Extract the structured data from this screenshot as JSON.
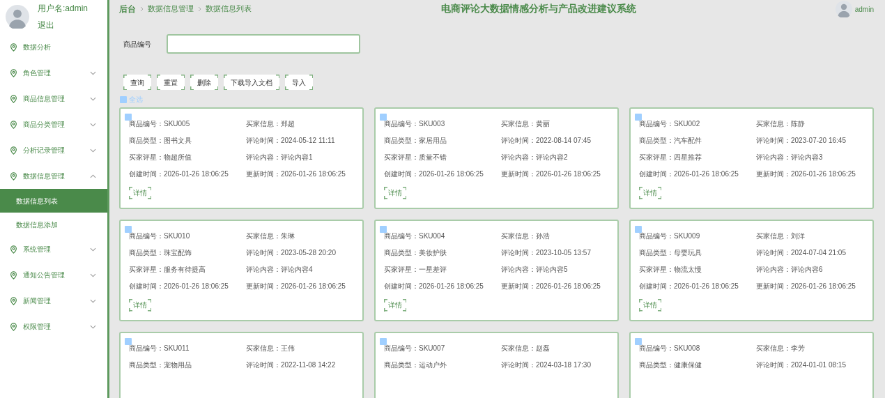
{
  "user": {
    "username": "用户名:admin",
    "logout": "退出"
  },
  "sidebar": {
    "items": [
      {
        "kind": "link",
        "label": "数据分析"
      },
      {
        "kind": "submenu",
        "label": "角色管理",
        "expanded": false
      },
      {
        "kind": "submenu",
        "label": "商品信息管理",
        "expanded": false
      },
      {
        "kind": "submenu",
        "label": "商品分类管理",
        "expanded": false
      },
      {
        "kind": "submenu",
        "label": "分析记录管理",
        "expanded": false
      },
      {
        "kind": "submenu",
        "label": "数据信息管理",
        "expanded": true,
        "children": [
          {
            "label": "数据信息列表",
            "selected": true
          },
          {
            "label": "数据信息添加",
            "selected": false
          }
        ]
      },
      {
        "kind": "submenu",
        "label": "系统管理",
        "expanded": false
      },
      {
        "kind": "submenu",
        "label": "通知公告管理",
        "expanded": false
      },
      {
        "kind": "submenu",
        "label": "新闻管理",
        "expanded": false
      },
      {
        "kind": "submenu",
        "label": "权限管理",
        "expanded": false
      }
    ]
  },
  "breadcrumb": [
    "后台",
    "数据信息管理",
    "数据信息列表"
  ],
  "title": "电商评论大数据情感分析与产品改进建议系统",
  "header_user": "admin",
  "search": {
    "label": "商品编号"
  },
  "buttons": [
    "查询",
    "重置",
    "删除",
    "下载导入文档",
    "导入"
  ],
  "select_all": {
    "label": "全选",
    "checked": false
  },
  "cards": [
    {
      "checked": false,
      "details": "详情",
      "fields": [
        {
          "label": "商品编号：",
          "value": "SKU005"
        },
        {
          "label": "买家信息：",
          "value": "郑超"
        },
        {
          "label": "商品类型：",
          "value": "图书文具"
        },
        {
          "label": "评论时间：",
          "value": "2024-05-12 11:11"
        },
        {
          "label": "买家评星：",
          "value": "物超所值"
        },
        {
          "label": "评论内容：",
          "value": "评论内容1"
        },
        {
          "label": "创建时间：",
          "value": "2026-01-26 18:06:25"
        },
        {
          "label": "更新时间：",
          "value": "2026-01-26 18:06:25"
        }
      ]
    },
    {
      "checked": false,
      "details": "详情",
      "fields": [
        {
          "label": "商品编号：",
          "value": "SKU003"
        },
        {
          "label": "买家信息：",
          "value": "黄丽"
        },
        {
          "label": "商品类型：",
          "value": "家居用品"
        },
        {
          "label": "评论时间：",
          "value": "2022-08-14 07:45"
        },
        {
          "label": "买家评星：",
          "value": "质量不错"
        },
        {
          "label": "评论内容：",
          "value": "评论内容2"
        },
        {
          "label": "创建时间：",
          "value": "2026-01-26 18:06:25"
        },
        {
          "label": "更新时间：",
          "value": "2026-01-26 18:06:25"
        }
      ]
    },
    {
      "checked": false,
      "details": "详情",
      "fields": [
        {
          "label": "商品编号：",
          "value": "SKU002"
        },
        {
          "label": "买家信息：",
          "value": "陈静"
        },
        {
          "label": "商品类型：",
          "value": "汽车配件"
        },
        {
          "label": "评论时间：",
          "value": "2023-07-20 16:45"
        },
        {
          "label": "买家评星：",
          "value": "四星推荐"
        },
        {
          "label": "评论内容：",
          "value": "评论内容3"
        },
        {
          "label": "创建时间：",
          "value": "2026-01-26 18:06:25"
        },
        {
          "label": "更新时间：",
          "value": "2026-01-26 18:06:25"
        }
      ]
    },
    {
      "checked": false,
      "details": "详情",
      "fields": [
        {
          "label": "商品编号：",
          "value": "SKU010"
        },
        {
          "label": "买家信息：",
          "value": "朱琳"
        },
        {
          "label": "商品类型：",
          "value": "珠宝配饰"
        },
        {
          "label": "评论时间：",
          "value": "2023-05-28 20:20"
        },
        {
          "label": "买家评星：",
          "value": "服务有待提高"
        },
        {
          "label": "评论内容：",
          "value": "评论内容4"
        },
        {
          "label": "创建时间：",
          "value": "2026-01-26 18:06:25"
        },
        {
          "label": "更新时间：",
          "value": "2026-01-26 18:06:25"
        }
      ]
    },
    {
      "checked": false,
      "details": "详情",
      "fields": [
        {
          "label": "商品编号：",
          "value": "SKU004"
        },
        {
          "label": "买家信息：",
          "value": "孙浩"
        },
        {
          "label": "商品类型：",
          "value": "美妆护肤"
        },
        {
          "label": "评论时间：",
          "value": "2023-10-05 13:57"
        },
        {
          "label": "买家评星：",
          "value": "一星差评"
        },
        {
          "label": "评论内容：",
          "value": "评论内容5"
        },
        {
          "label": "创建时间：",
          "value": "2026-01-26 18:06:25"
        },
        {
          "label": "更新时间：",
          "value": "2026-01-26 18:06:25"
        }
      ]
    },
    {
      "checked": false,
      "details": "详情",
      "fields": [
        {
          "label": "商品编号：",
          "value": "SKU009"
        },
        {
          "label": "买家信息：",
          "value": "刘洋"
        },
        {
          "label": "商品类型：",
          "value": "母婴玩具"
        },
        {
          "label": "评论时间：",
          "value": "2024-07-04 21:05"
        },
        {
          "label": "买家评星：",
          "value": "物流太慢"
        },
        {
          "label": "评论内容：",
          "value": "评论内容6"
        },
        {
          "label": "创建时间：",
          "value": "2026-01-26 18:06:25"
        },
        {
          "label": "更新时间：",
          "value": "2026-01-26 18:06:25"
        }
      ]
    },
    {
      "checked": false,
      "fields": [
        {
          "label": "商品编号：",
          "value": "SKU011"
        },
        {
          "label": "买家信息：",
          "value": "王伟"
        },
        {
          "label": "商品类型：",
          "value": "宠物用品"
        },
        {
          "label": "评论时间：",
          "value": "2022-11-08 14:22"
        }
      ]
    },
    {
      "checked": false,
      "fields": [
        {
          "label": "商品编号：",
          "value": "SKU007"
        },
        {
          "label": "买家信息：",
          "value": "赵磊"
        },
        {
          "label": "商品类型：",
          "value": "运动户外"
        },
        {
          "label": "评论时间：",
          "value": "2024-03-18 17:30"
        }
      ]
    },
    {
      "checked": false,
      "fields": [
        {
          "label": "商品编号：",
          "value": "SKU008"
        },
        {
          "label": "买家信息：",
          "value": "李芳"
        },
        {
          "label": "商品类型：",
          "value": "健康保健"
        },
        {
          "label": "评论时间：",
          "value": "2024-01-01 08:15"
        }
      ]
    }
  ]
}
